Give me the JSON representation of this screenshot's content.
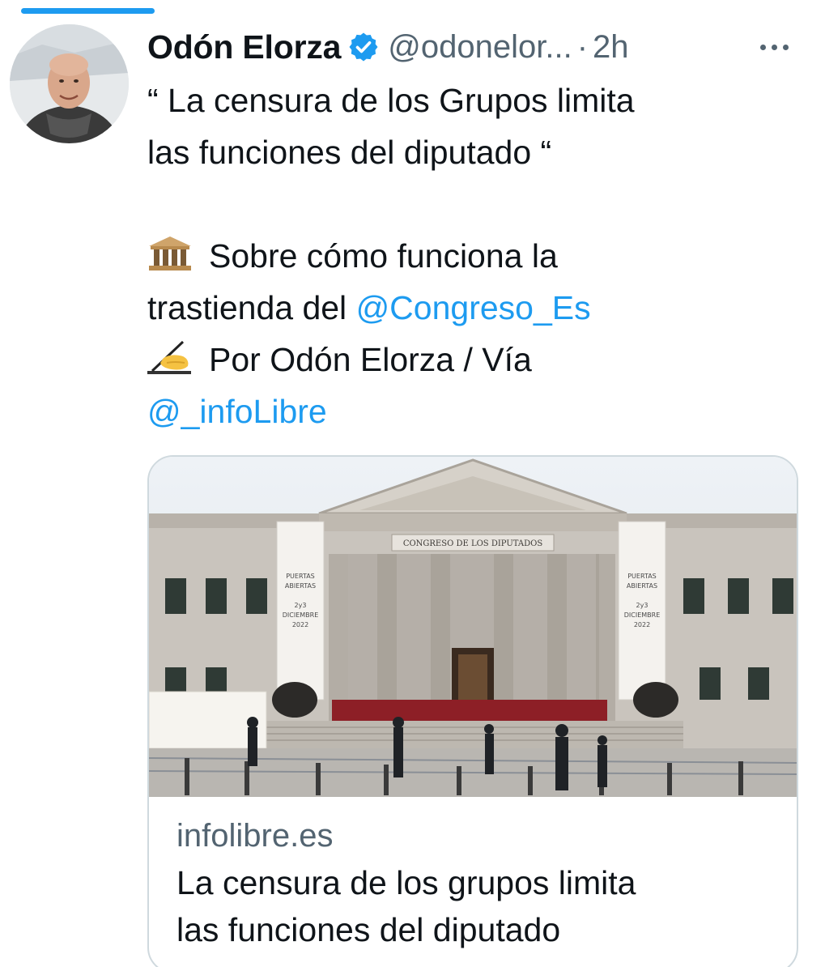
{
  "author": {
    "name": "Odón Elorza",
    "handle": "@odonelor...",
    "separator": "·",
    "time": "2h"
  },
  "tweet": {
    "line1": "“ La censura de los Grupos limita",
    "line2": "las funciones del diputado “",
    "line3_text": "Sobre cómo funciona la",
    "line4_text": "trastienda del ",
    "line4_mention": "@Congreso_Es",
    "line5_text": "Por Odón Elorza / Vía",
    "line6_mention": "@_infoLibre"
  },
  "card": {
    "image_sign": "CONGRESO DE LOS DIPUTADOS",
    "banner_left": [
      "PUERTAS",
      "ABIERTAS",
      "2y3",
      "DICIEMBRE",
      "2022"
    ],
    "banner_right": [
      "PUERTAS",
      "ABIERTAS",
      "2y3",
      "DICIEMBRE",
      "2022"
    ],
    "domain": "infolibre.es",
    "title_line1": "La censura de los grupos limita",
    "title_line2": "las funciones del diputado"
  },
  "icons": {
    "verified": "verified-badge-icon",
    "more": "more-options-icon",
    "building_emoji": "classical-building-icon",
    "writing_emoji": "writing-hand-icon"
  },
  "colors": {
    "accent": "#1d9bf0",
    "text": "#0f1419",
    "secondary": "#536471",
    "border": "#cfd9de"
  }
}
